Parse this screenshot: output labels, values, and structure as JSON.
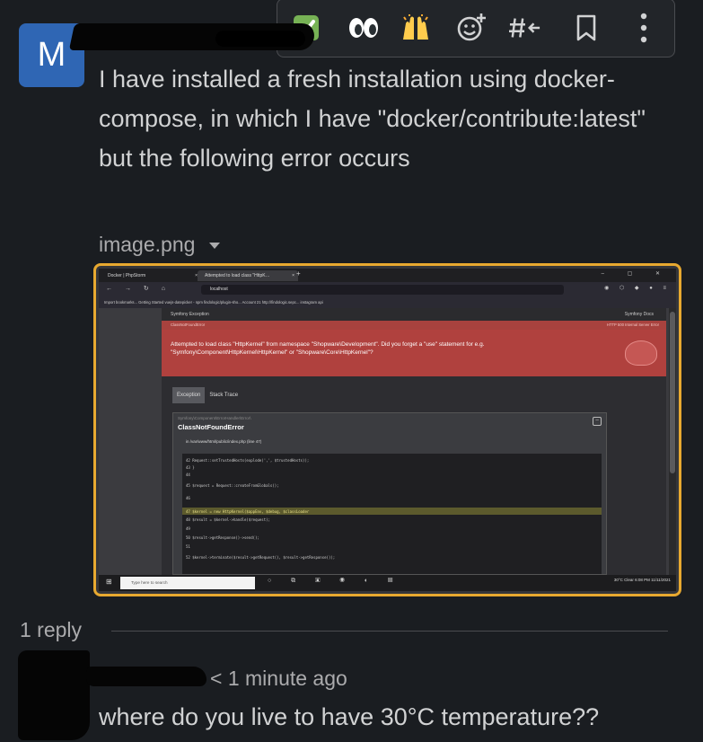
{
  "toolbar": {
    "actions": [
      {
        "icon": "check-emoji-icon",
        "label": "Mark as done"
      },
      {
        "icon": "eyes-emoji-icon",
        "label": "Eyes"
      },
      {
        "icon": "raised-hands-emoji-icon",
        "label": "Raised hands"
      },
      {
        "icon": "add-reaction-icon",
        "label": "Add reaction"
      },
      {
        "icon": "reply-in-thread-icon",
        "label": "Reply in thread"
      },
      {
        "icon": "bookmark-icon",
        "label": "Save"
      },
      {
        "icon": "more-actions-icon",
        "label": "More actions"
      }
    ]
  },
  "message": {
    "avatar_letter": "M",
    "text": "I have installed a fresh installation using docker-compose, in which I have \"docker/contribute:latest\" but the following error occurs",
    "attachment": {
      "filename": "image.png",
      "screenshot": {
        "tabs": [
          "Docker | PhpStorm",
          "Attempted to load class \"HttpK…"
        ],
        "url": "localhost",
        "bookmarks": "Import bookmarks...   Getting Started   vuejs-datepicker - npm   findologic/plugin-sho...   Account 21   http://findologic.sepc...   instagram api",
        "symfony_header_left": "Symfony Exception",
        "symfony_header_right": "Symfony Docs",
        "status_left": "ClassNotFoundError",
        "status_right": "HTTP 500 Internal Server Error",
        "error_text": "Attempted to load class \"HttpKernel\" from namespace \"Shopware\\Development\". Did you forget a \"use\" statement for e.g. \"Symfony\\Component\\HttpKernel\\HttpKernel\" or \"Shopware\\Core\\HttpKernel\"?",
        "tab_exception": "Exception",
        "tab_stacktrace": "Stack Trace",
        "card_small": "Symfony\\Component\\ErrorHandler\\Error\\",
        "card_class": "ClassNotFoundError",
        "card_path": "in /var/www/html/public/index.php (line 47)",
        "code_lines": [
          "42        Request::setTrustedHosts(explode(',', $trustedHosts));",
          "43    }",
          "44",
          "45    $request = Request::createFromGlobals();",
          "46",
          "47    $kernel = new HttpKernel($appEnv, $debug, $classLoader",
          "48    $result = $kernel->handle($request);",
          "49",
          "50    $result->getResponse()->send();",
          "51",
          "52    $kernel->terminate($result->getRequest(), $result->getResponse());"
        ],
        "taskbar_search": "Type here to search",
        "taskbar_right": "30°C  Clear   6:08 PM  11/11/2021"
      }
    }
  },
  "thread": {
    "reply_count": "1 reply",
    "reply_time": "< 1 minute ago",
    "reply_text": "where do you live to have 30°C temperature??"
  }
}
